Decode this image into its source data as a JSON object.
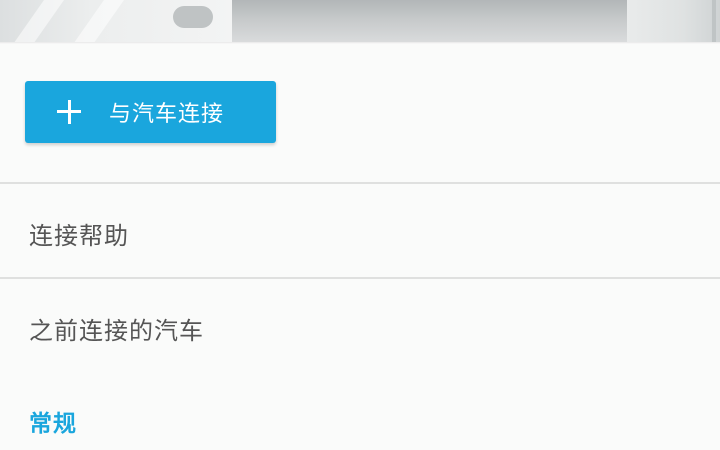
{
  "hero": {
    "icon": "car-banner-image"
  },
  "connect_button": {
    "label": "与汽车连接",
    "icon": "plus-icon",
    "color": "#1aa6dd"
  },
  "menu": {
    "items": [
      {
        "label": "连接帮助"
      },
      {
        "label": "之前连接的汽车"
      }
    ]
  },
  "section": {
    "title": "常规",
    "accent": "#1aa6dd"
  }
}
